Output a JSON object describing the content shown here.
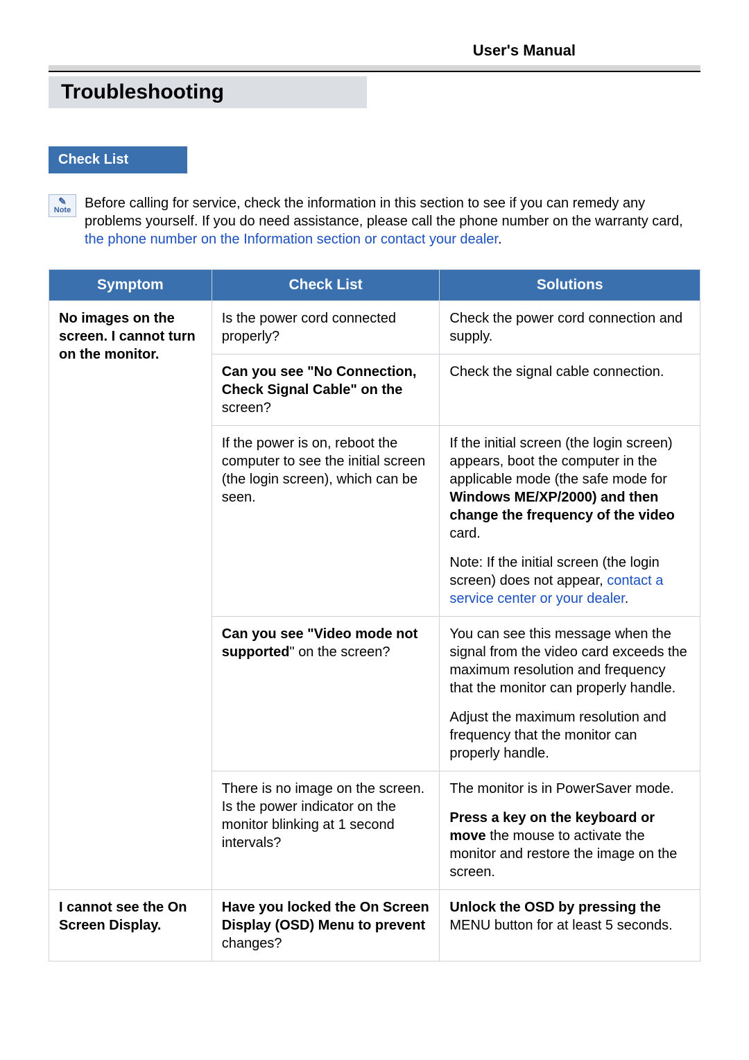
{
  "manual_title": "User's Manual",
  "section_title": "Troubleshooting",
  "subsection_title": "Check List",
  "note_label": "Note",
  "note_text_1": "Before calling for service, check the information in this section to see if you can remedy any problems yourself. If you do need assistance, please call the phone number on the warranty card, ",
  "note_link": "the phone number on the Information section or contact your dealer",
  "note_text_2": ".",
  "table": {
    "headers": {
      "symptom": "Symptom",
      "check": "Check List",
      "solution": "Solutions"
    },
    "rows": {
      "s1": "No images on the screen. I cannot turn on the monitor.",
      "r1c": "Is the power cord connected properly?",
      "r1s": "Check the power cord connection and supply.",
      "r2c_b": "Can you see \"No Connection, Check Signal Cable\" on the",
      "r2c_t": " screen?",
      "r2s": "Check the signal cable connection.",
      "r3c": "If the power is on, reboot the computer to see the initial screen (the login screen), which can be seen.",
      "r3s_1": "If the initial screen (the login screen) appears, boot the computer in the applicable mode (the safe mode for ",
      "r3s_b": "Windows ME/XP/2000) and then change the frequency of the video",
      "r3s_2": " card.",
      "r3s_note_1": "Note: If the initial screen (the login screen) does not appear, ",
      "r3s_link": "contact a service center or your dealer",
      "r3s_note_2": ".",
      "r4c_b": "Can you see \"Video mode not supported",
      "r4c_t": "\" on the screen?",
      "r4s_1": "You can see this message when the signal from the video card exceeds the maximum resolution and frequency that the monitor can properly handle.",
      "r4s_2": "Adjust the maximum resolution and frequency that the monitor can properly handle.",
      "r5c": "There is no image on the screen. Is the power indicator on the monitor blinking at 1 second intervals?",
      "r5s_1": "The monitor is in PowerSaver mode.",
      "r5s_b": "Press a key on the keyboard or move",
      "r5s_2": " the mouse to activate the monitor and restore the image on the screen.",
      "s2": "I cannot see the On Screen Display.",
      "r6c_b": "Have you locked the On Screen Display (OSD) Menu to prevent",
      "r6c_t": " changes?",
      "r6s_b": "Unlock the OSD by pressing the",
      "r6s_t": " MENU button for at least 5 seconds."
    }
  }
}
